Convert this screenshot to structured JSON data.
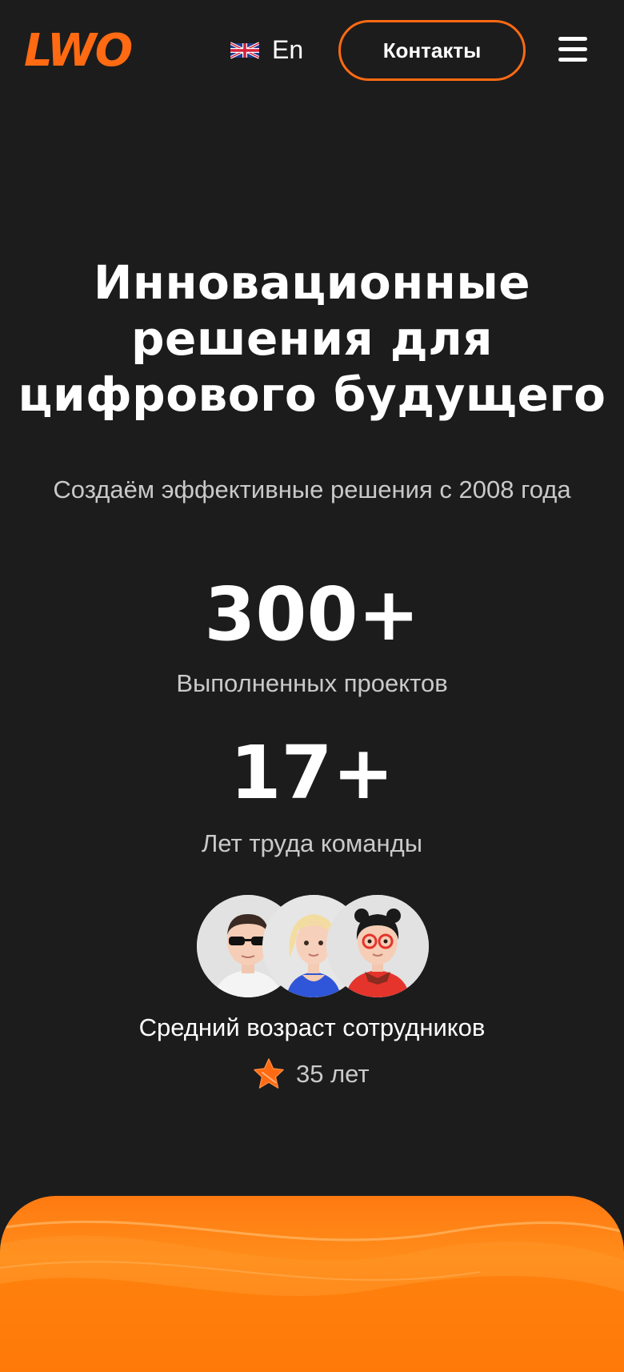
{
  "header": {
    "logo": "LWO",
    "language": "En",
    "contacts_label": "Контакты"
  },
  "hero": {
    "title_lines": [
      "Инновационные",
      "решения для",
      "цифрового будущего"
    ],
    "subtitle": "Создаём эффективные решения с 2008 года"
  },
  "stats": [
    {
      "value": "300+",
      "label": "Выполненных проектов"
    },
    {
      "value": "17+",
      "label": "Лет труда команды"
    }
  ],
  "team": {
    "age_label": "Средний возраст сотрудников",
    "age_value": "35 лет"
  },
  "colors": {
    "background": "#1c1c1c",
    "accent": "#ff6a13",
    "muted_text": "#c9c9c9"
  },
  "icons": [
    "uk-flag-icon",
    "menu-icon",
    "star-icon"
  ]
}
